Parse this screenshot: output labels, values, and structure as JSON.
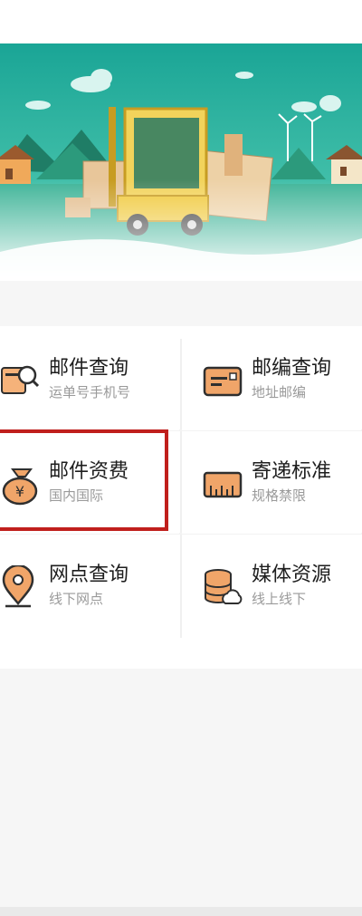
{
  "colors": {
    "teal_dark": "#1aa596",
    "teal_light": "#5dd1b6",
    "orange_icon": "#e8894f",
    "highlight_red": "#c01f1c"
  },
  "banner": {
    "illustration": "forklift-with-parcels"
  },
  "services": [
    {
      "title": "邮件查询",
      "subtitle": "运单号手机号",
      "icon": "parcel-search-icon"
    },
    {
      "title": "邮编查询",
      "subtitle": "地址邮编",
      "icon": "postcode-card-icon"
    },
    {
      "title": "邮件资费",
      "subtitle": "国内国际",
      "icon": "money-bag-icon"
    },
    {
      "title": "寄递标准",
      "subtitle": "规格禁限",
      "icon": "ruler-icon"
    },
    {
      "title": "网点查询",
      "subtitle": "线下网点",
      "icon": "map-pin-icon"
    },
    {
      "title": "媒体资源",
      "subtitle": "线上线下",
      "icon": "database-cloud-icon"
    }
  ]
}
